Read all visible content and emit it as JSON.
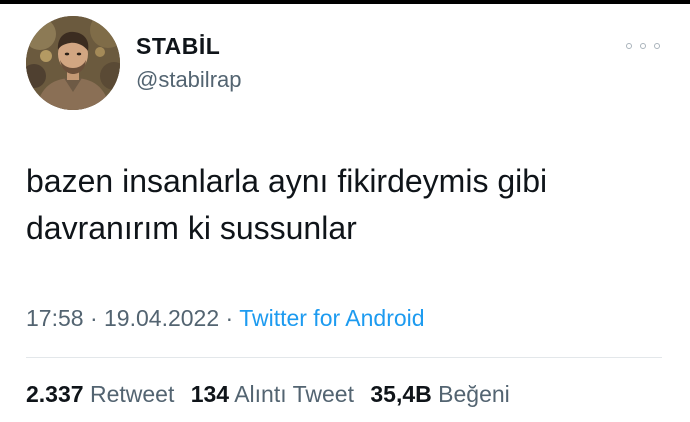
{
  "author": {
    "display_name": "STABİL",
    "handle": "@stabilrap",
    "avatar_icon": "profile-photo"
  },
  "menu": {
    "icon": "more-dots-icon"
  },
  "tweet": {
    "lines": [
      "bazen insanlarla aynı fikirdeymis gibi",
      "davranırım ki sussunlar"
    ]
  },
  "meta": {
    "time": "17:58",
    "separator": "·",
    "date": "19.04.2022",
    "source": "Twitter for Android"
  },
  "stats": {
    "retweets": {
      "count": "2.337",
      "label": "Retweet"
    },
    "quotes": {
      "count": "134",
      "label": "Alıntı Tweet"
    },
    "likes": {
      "count": "35,4B",
      "label": "Beğeni"
    }
  },
  "colors": {
    "text": "#0f1419",
    "secondary": "#536471",
    "link": "#1d9bf0",
    "divider": "#e3e7ea"
  }
}
